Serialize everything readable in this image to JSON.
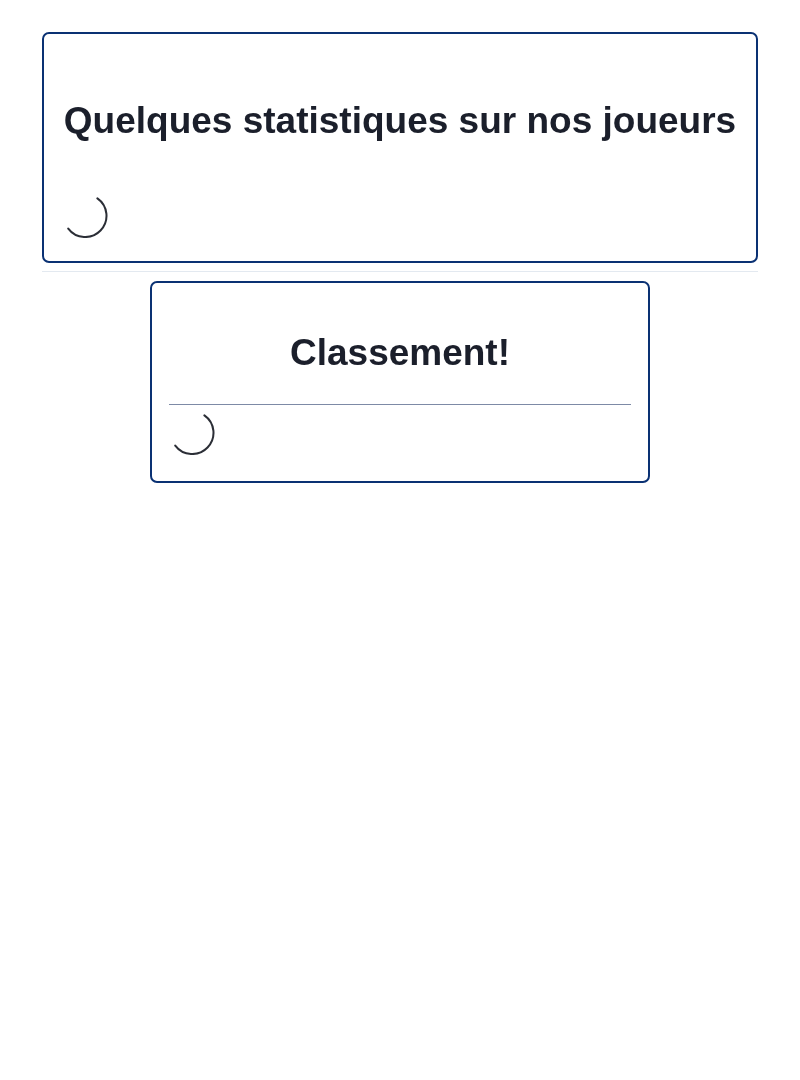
{
  "cards": [
    {
      "title": "Quelques statistiques sur nos joueurs",
      "kind": "wide",
      "divider": false,
      "loading": true
    },
    {
      "title": "Classement!",
      "kind": "narrow",
      "divider": true,
      "loading": true
    }
  ]
}
